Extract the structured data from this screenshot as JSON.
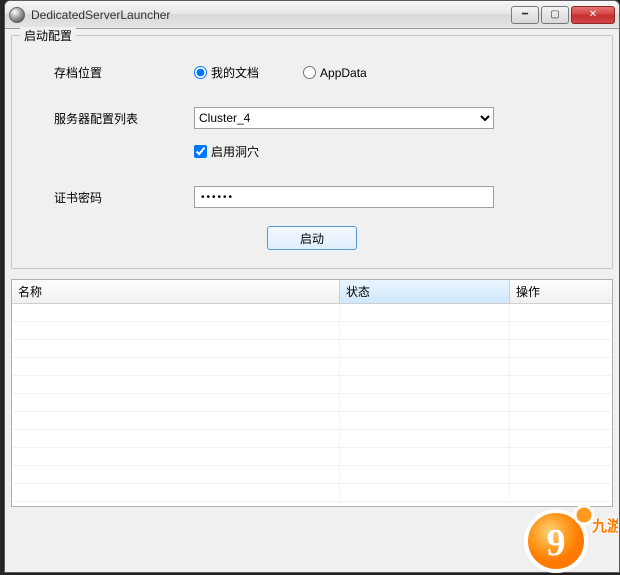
{
  "window": {
    "title": "DedicatedServerLauncher"
  },
  "group": {
    "legend": "启动配置"
  },
  "labels": {
    "save_location": "存档位置",
    "server_config_list": "服务器配置列表",
    "cert_password": "证书密码"
  },
  "radios": {
    "my_documents": "我的文档",
    "appdata": "AppData"
  },
  "combo": {
    "selected": "Cluster_4"
  },
  "checkbox": {
    "enable_caves": "启用洞穴"
  },
  "password": {
    "value": "••••••"
  },
  "buttons": {
    "launch": "启动"
  },
  "table": {
    "headers": {
      "name": "名称",
      "status": "状态",
      "action": "操作"
    }
  },
  "watermark": {
    "text": "九游"
  }
}
